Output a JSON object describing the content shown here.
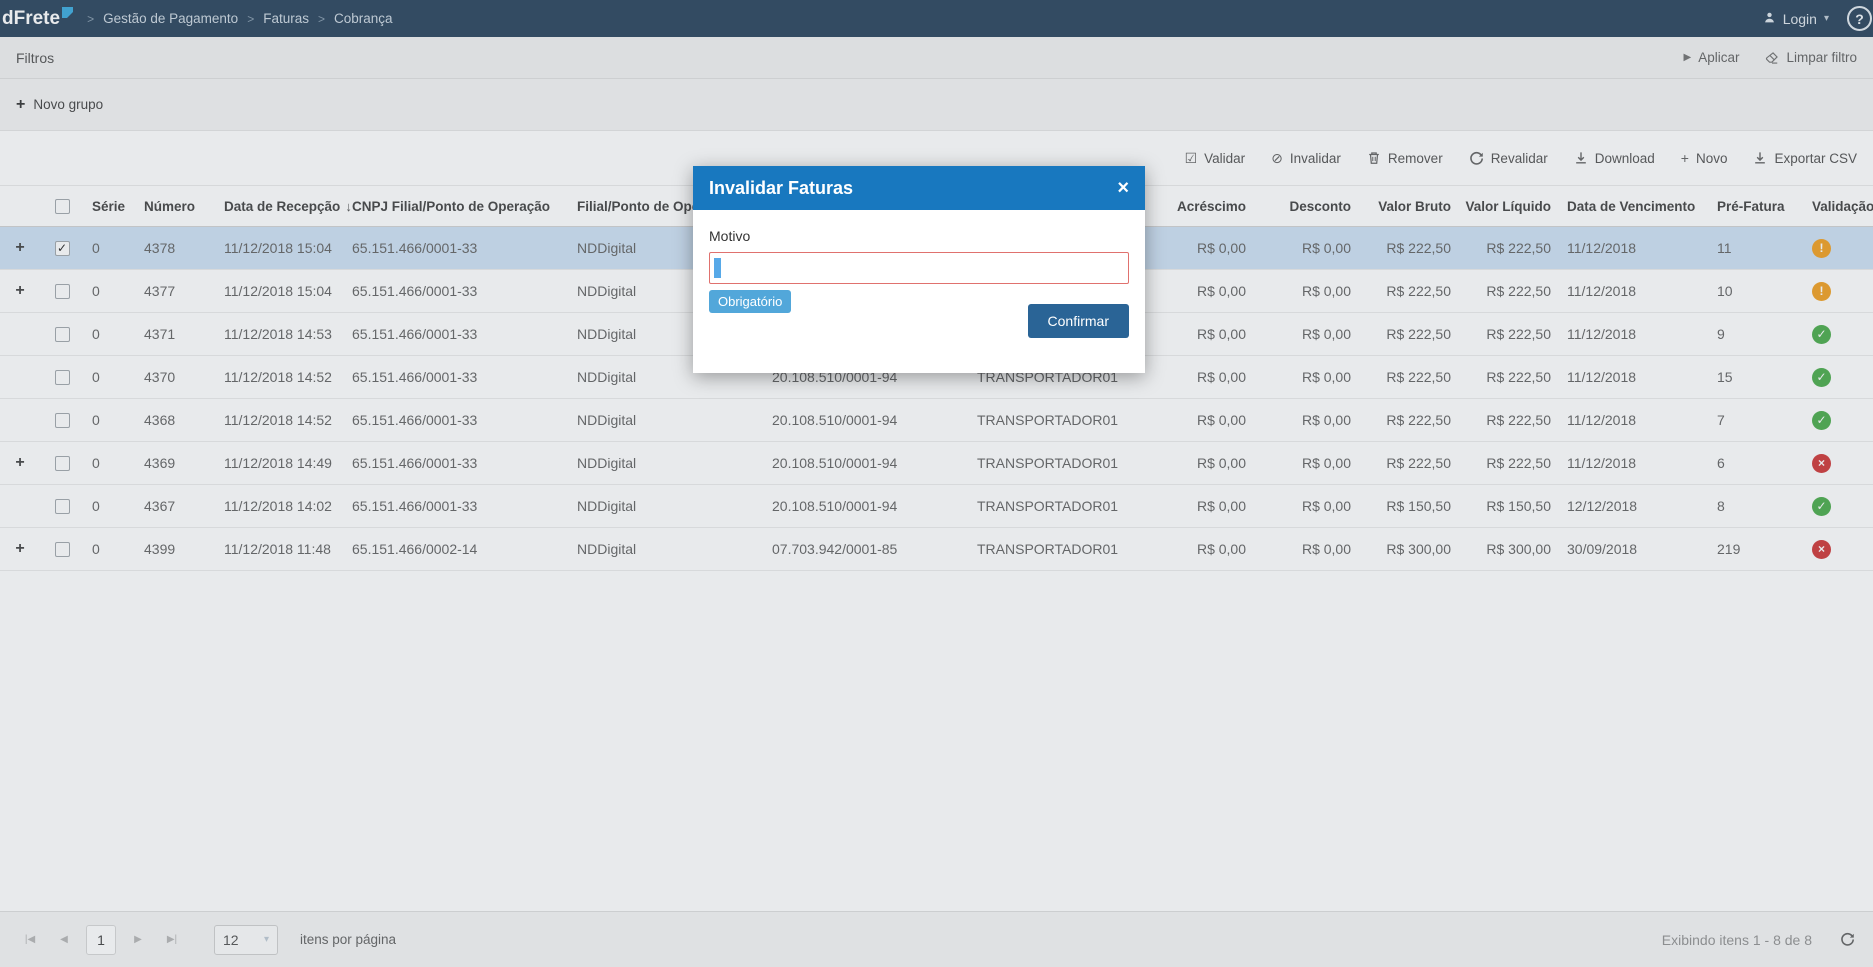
{
  "navbar": {
    "logo": "dFrete",
    "breadcrumb": [
      "Gestão de Pagamento",
      "Faturas",
      "Cobrança"
    ],
    "login_label": "Login"
  },
  "icons": {
    "breadcrumb_sep": ">",
    "caret_down": "▾",
    "help": "?",
    "play": "▶",
    "plus": "+",
    "sort_desc": "↓",
    "validar": "☑",
    "invalidar": "⊘",
    "check": "✓",
    "close": "×",
    "status_warning": "!",
    "status_success": "✓",
    "status_error": "×",
    "pager_first": "|◀",
    "pager_prev": "◀",
    "pager_next": "▶",
    "pager_last": "▶|"
  },
  "filters": {
    "title": "Filtros",
    "apply_label": "Aplicar",
    "clear_label": "Limpar filtro",
    "new_group_label": "Novo grupo"
  },
  "toolbar": {
    "buttons": [
      {
        "name": "validate-button",
        "icon": "validar",
        "label": "Validar"
      },
      {
        "name": "invalidate-button",
        "icon": "invalidar",
        "label": "Invalidar"
      },
      {
        "name": "remove-button",
        "icon": "trash",
        "label": "Remover"
      },
      {
        "name": "revalidate-button",
        "icon": "refresh",
        "label": "Revalidar"
      },
      {
        "name": "download-button",
        "icon": "download",
        "label": "Download"
      },
      {
        "name": "new-button",
        "icon": "plus",
        "label": "Novo"
      },
      {
        "name": "export-csv-button",
        "icon": "export",
        "label": "Exportar CSV"
      }
    ]
  },
  "table": {
    "sort_column": 4,
    "columns": [
      "",
      "",
      "Série",
      "Número",
      "Data de Recepção",
      "CNPJ Filial/Ponto de Operação",
      "Filial/Ponto de Operação",
      "",
      "",
      "Acréscimo",
      "Desconto",
      "Valor Bruto",
      "Valor Líquido",
      "Data de Vencimento",
      "Pré-Fatura",
      "Validação"
    ],
    "rows": [
      {
        "expand": true,
        "checked": true,
        "selected": true,
        "serie": "0",
        "numero": "4378",
        "recepcao": "11/12/2018 15:04",
        "cnpj_filial": "65.151.466/0001-33",
        "filial": "NDDigital",
        "cnpj_transportador": "",
        "transportador": "",
        "acrescimo": "R$ 0,00",
        "desconto": "R$ 0,00",
        "valor_bruto": "R$ 222,50",
        "valor_liquido": "R$ 222,50",
        "vencimento": "11/12/2018",
        "pre_fatura": "11",
        "status": "warning"
      },
      {
        "expand": true,
        "checked": false,
        "selected": false,
        "serie": "0",
        "numero": "4377",
        "recepcao": "11/12/2018 15:04",
        "cnpj_filial": "65.151.466/0001-33",
        "filial": "NDDigital",
        "cnpj_transportador": "",
        "transportador": "",
        "acrescimo": "R$ 0,00",
        "desconto": "R$ 0,00",
        "valor_bruto": "R$ 222,50",
        "valor_liquido": "R$ 222,50",
        "vencimento": "11/12/2018",
        "pre_fatura": "10",
        "status": "warning"
      },
      {
        "expand": false,
        "checked": false,
        "selected": false,
        "serie": "0",
        "numero": "4371",
        "recepcao": "11/12/2018 14:53",
        "cnpj_filial": "65.151.466/0001-33",
        "filial": "NDDigital",
        "cnpj_transportador": "",
        "transportador": "",
        "acrescimo": "R$ 0,00",
        "desconto": "R$ 0,00",
        "valor_bruto": "R$ 222,50",
        "valor_liquido": "R$ 222,50",
        "vencimento": "11/12/2018",
        "pre_fatura": "9",
        "status": "success"
      },
      {
        "expand": false,
        "checked": false,
        "selected": false,
        "serie": "0",
        "numero": "4370",
        "recepcao": "11/12/2018 14:52",
        "cnpj_filial": "65.151.466/0001-33",
        "filial": "NDDigital",
        "cnpj_transportador": "20.108.510/0001-94",
        "transportador": "TRANSPORTADOR01",
        "acrescimo": "R$ 0,00",
        "desconto": "R$ 0,00",
        "valor_bruto": "R$ 222,50",
        "valor_liquido": "R$ 222,50",
        "vencimento": "11/12/2018",
        "pre_fatura": "15",
        "status": "success"
      },
      {
        "expand": false,
        "checked": false,
        "selected": false,
        "serie": "0",
        "numero": "4368",
        "recepcao": "11/12/2018 14:52",
        "cnpj_filial": "65.151.466/0001-33",
        "filial": "NDDigital",
        "cnpj_transportador": "20.108.510/0001-94",
        "transportador": "TRANSPORTADOR01",
        "acrescimo": "R$ 0,00",
        "desconto": "R$ 0,00",
        "valor_bruto": "R$ 222,50",
        "valor_liquido": "R$ 222,50",
        "vencimento": "11/12/2018",
        "pre_fatura": "7",
        "status": "success"
      },
      {
        "expand": true,
        "checked": false,
        "selected": false,
        "serie": "0",
        "numero": "4369",
        "recepcao": "11/12/2018 14:49",
        "cnpj_filial": "65.151.466/0001-33",
        "filial": "NDDigital",
        "cnpj_transportador": "20.108.510/0001-94",
        "transportador": "TRANSPORTADOR01",
        "acrescimo": "R$ 0,00",
        "desconto": "R$ 0,00",
        "valor_bruto": "R$ 222,50",
        "valor_liquido": "R$ 222,50",
        "vencimento": "11/12/2018",
        "pre_fatura": "6",
        "status": "error"
      },
      {
        "expand": false,
        "checked": false,
        "selected": false,
        "serie": "0",
        "numero": "4367",
        "recepcao": "11/12/2018 14:02",
        "cnpj_filial": "65.151.466/0001-33",
        "filial": "NDDigital",
        "cnpj_transportador": "20.108.510/0001-94",
        "transportador": "TRANSPORTADOR01",
        "acrescimo": "R$ 0,00",
        "desconto": "R$ 0,00",
        "valor_bruto": "R$ 150,50",
        "valor_liquido": "R$ 150,50",
        "vencimento": "12/12/2018",
        "pre_fatura": "8",
        "status": "success"
      },
      {
        "expand": true,
        "checked": false,
        "selected": false,
        "serie": "0",
        "numero": "4399",
        "recepcao": "11/12/2018 11:48",
        "cnpj_filial": "65.151.466/0002-14",
        "filial": "NDDigital",
        "cnpj_transportador": "07.703.942/0001-85",
        "transportador": "TRANSPORTADOR01",
        "acrescimo": "R$ 0,00",
        "desconto": "R$ 0,00",
        "valor_bruto": "R$ 300,00",
        "valor_liquido": "R$ 300,00",
        "vencimento": "30/09/2018",
        "pre_fatura": "219",
        "status": "error"
      }
    ]
  },
  "modal": {
    "title": "Invalidar Faturas",
    "label": "Motivo",
    "input_value": "",
    "required_badge": "Obrigatório",
    "confirm_label": "Confirmar"
  },
  "pagination": {
    "current_page": "1",
    "page_size": "12",
    "page_size_label": "itens por página",
    "status": "Exibindo itens 1 - 8 de 8"
  }
}
